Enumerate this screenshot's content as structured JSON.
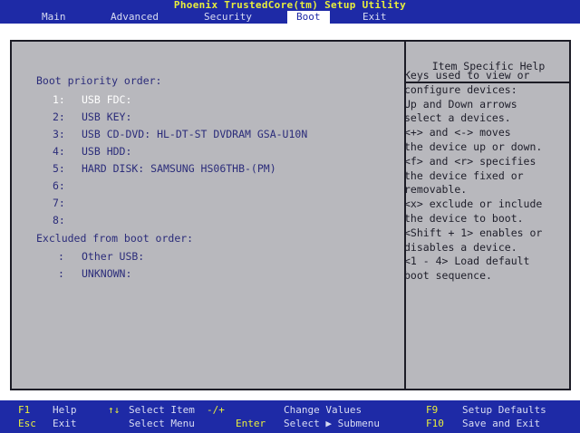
{
  "title": "Phoenix TrustedCore(tm) Setup Utility",
  "menu": [
    "Main",
    "Advanced",
    "Security",
    "Boot",
    "Exit"
  ],
  "active_menu": "Boot",
  "boot_priority_title": "Boot priority order:",
  "boot_items": [
    {
      "num": "1:",
      "device": "USB FDC:"
    },
    {
      "num": "2:",
      "device": "USB KEY:"
    },
    {
      "num": "3:",
      "device": "USB CD-DVD: HL-DT-ST DVDRAM GSA-U10N"
    },
    {
      "num": "4:",
      "device": "USB HDD:"
    },
    {
      "num": "5:",
      "device": "HARD DISK: SAMSUNG HS06THB-(PM)"
    },
    {
      "num": "6:",
      "device": ""
    },
    {
      "num": "7:",
      "device": ""
    },
    {
      "num": "8:",
      "device": ""
    }
  ],
  "excluded_title": "Excluded from boot order:",
  "excluded_items": [
    {
      "num": ":",
      "device": "Other USB:"
    },
    {
      "num": ":",
      "device": "UNKNOWN:"
    }
  ],
  "help_title": "Item Specific Help",
  "help_lines": [
    "Keys used to view or",
    "configure devices:",
    "Up and Down arrows",
    "select a devices.",
    "<+> and <-> moves",
    "the device up or down.",
    "<f> and <r> specifies",
    "the device fixed or",
    "removable.",
    "<x> exclude or include",
    "the device to boot.",
    "<Shift + 1> enables or",
    "disables a device.",
    "<1 - 4> Load default",
    "boot sequence."
  ],
  "footer": {
    "f1": "F1",
    "help": "Help",
    "arrows_ud": "↑↓",
    "select_item": "Select Item",
    "plus_minus": "-/+",
    "change_values": "Change Values",
    "f9": "F9",
    "setup_defaults": "Setup Defaults",
    "esc": "Esc",
    "exit": "Exit",
    "select_menu": "Select Menu",
    "enter": "Enter",
    "select_submenu": "Select ▶ Submenu",
    "f10": "F10",
    "save_exit": "Save and Exit"
  }
}
